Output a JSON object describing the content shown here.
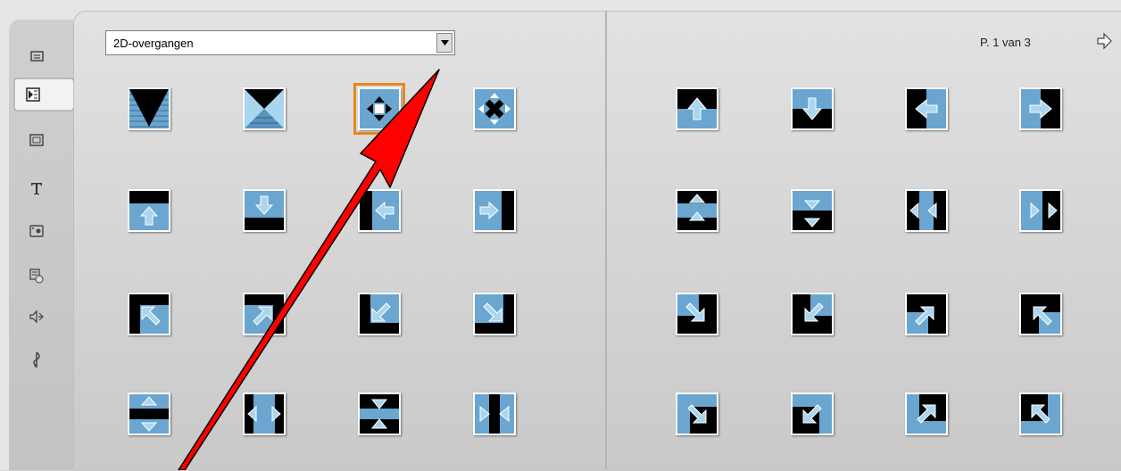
{
  "sidebar": {
    "items": [
      {
        "icon": "caption-icon"
      },
      {
        "icon": "transitions-icon",
        "active": true
      },
      {
        "icon": "frames-icon"
      },
      {
        "icon": "title-text-icon"
      },
      {
        "icon": "photo-icon"
      },
      {
        "icon": "disc-menu-icon"
      },
      {
        "icon": "sound-effects-icon"
      },
      {
        "icon": "music-icon"
      }
    ]
  },
  "transitions": {
    "category": "2D-overgangen",
    "page_label": "P. 1 van 3",
    "selected_index": 2
  },
  "colors": {
    "accent_blue": "#6aa6cf",
    "selection": "#e8861a",
    "annotation_arrow": "#ff0000"
  }
}
